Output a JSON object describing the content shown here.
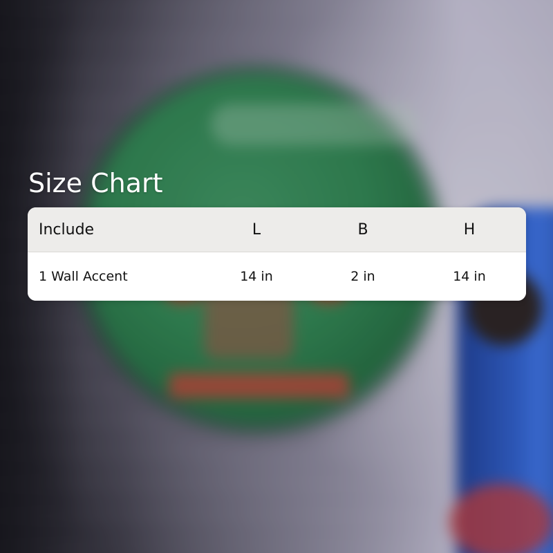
{
  "title": "Size Chart",
  "table": {
    "headers": {
      "include": "Include",
      "l": "L",
      "b": "B",
      "h": "H"
    },
    "rows": [
      {
        "include": "1 Wall Accent",
        "l": "14 in",
        "b": "2 in",
        "h": "14 in"
      }
    ]
  },
  "colors": {
    "title_text": "#ffffff",
    "header_bg": "#edecea",
    "row_bg": "#ffffff",
    "text": "#111111"
  }
}
